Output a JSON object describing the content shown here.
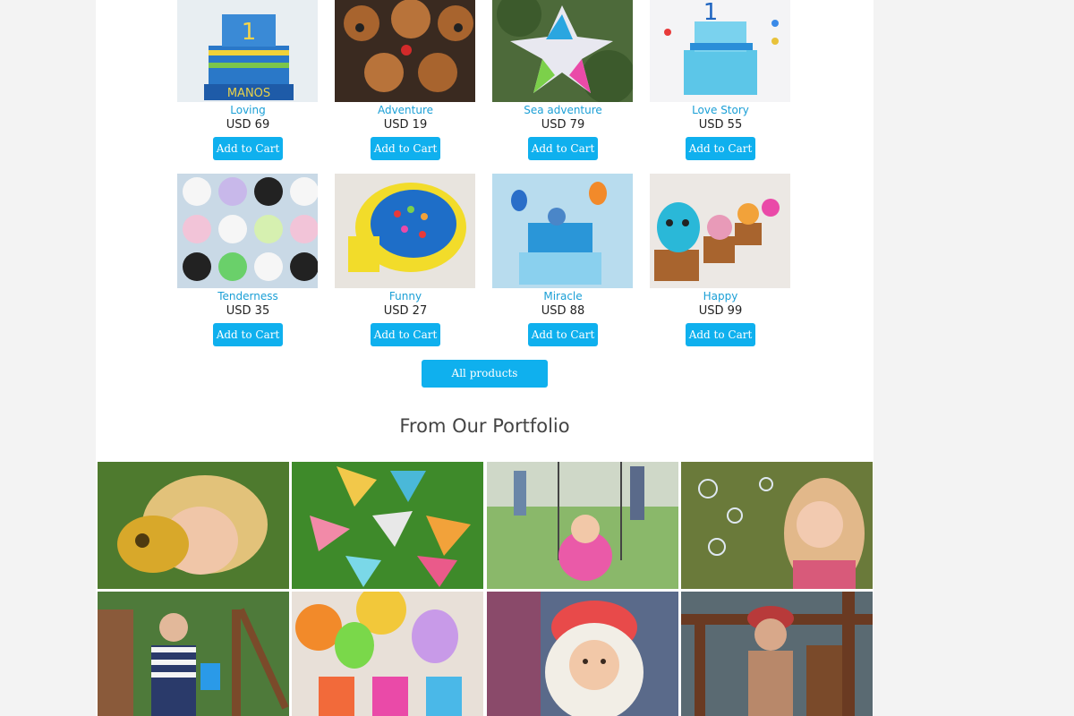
{
  "products": [
    {
      "name": "Loving",
      "price": "USD 69",
      "button": "Add to Cart"
    },
    {
      "name": "Adventure",
      "price": "USD 19",
      "button": "Add to Cart"
    },
    {
      "name": "Sea adventure",
      "price": "USD 79",
      "button": "Add to Cart"
    },
    {
      "name": "Love Story",
      "price": "USD 55",
      "button": "Add to Cart"
    },
    {
      "name": "Tenderness",
      "price": "USD 35",
      "button": "Add to Cart"
    },
    {
      "name": "Funny",
      "price": "USD 27",
      "button": "Add to Cart"
    },
    {
      "name": "Miracle",
      "price": "USD 88",
      "button": "Add to Cart"
    },
    {
      "name": "Happy",
      "price": "USD 99",
      "button": "Add to Cart"
    }
  ],
  "all_products_label": "All products",
  "portfolio": {
    "title": "From Our Portfolio"
  },
  "colors": {
    "accent": "#0fb0ee",
    "link": "#1a9fd6",
    "page_bg": "#f3f3f3"
  }
}
